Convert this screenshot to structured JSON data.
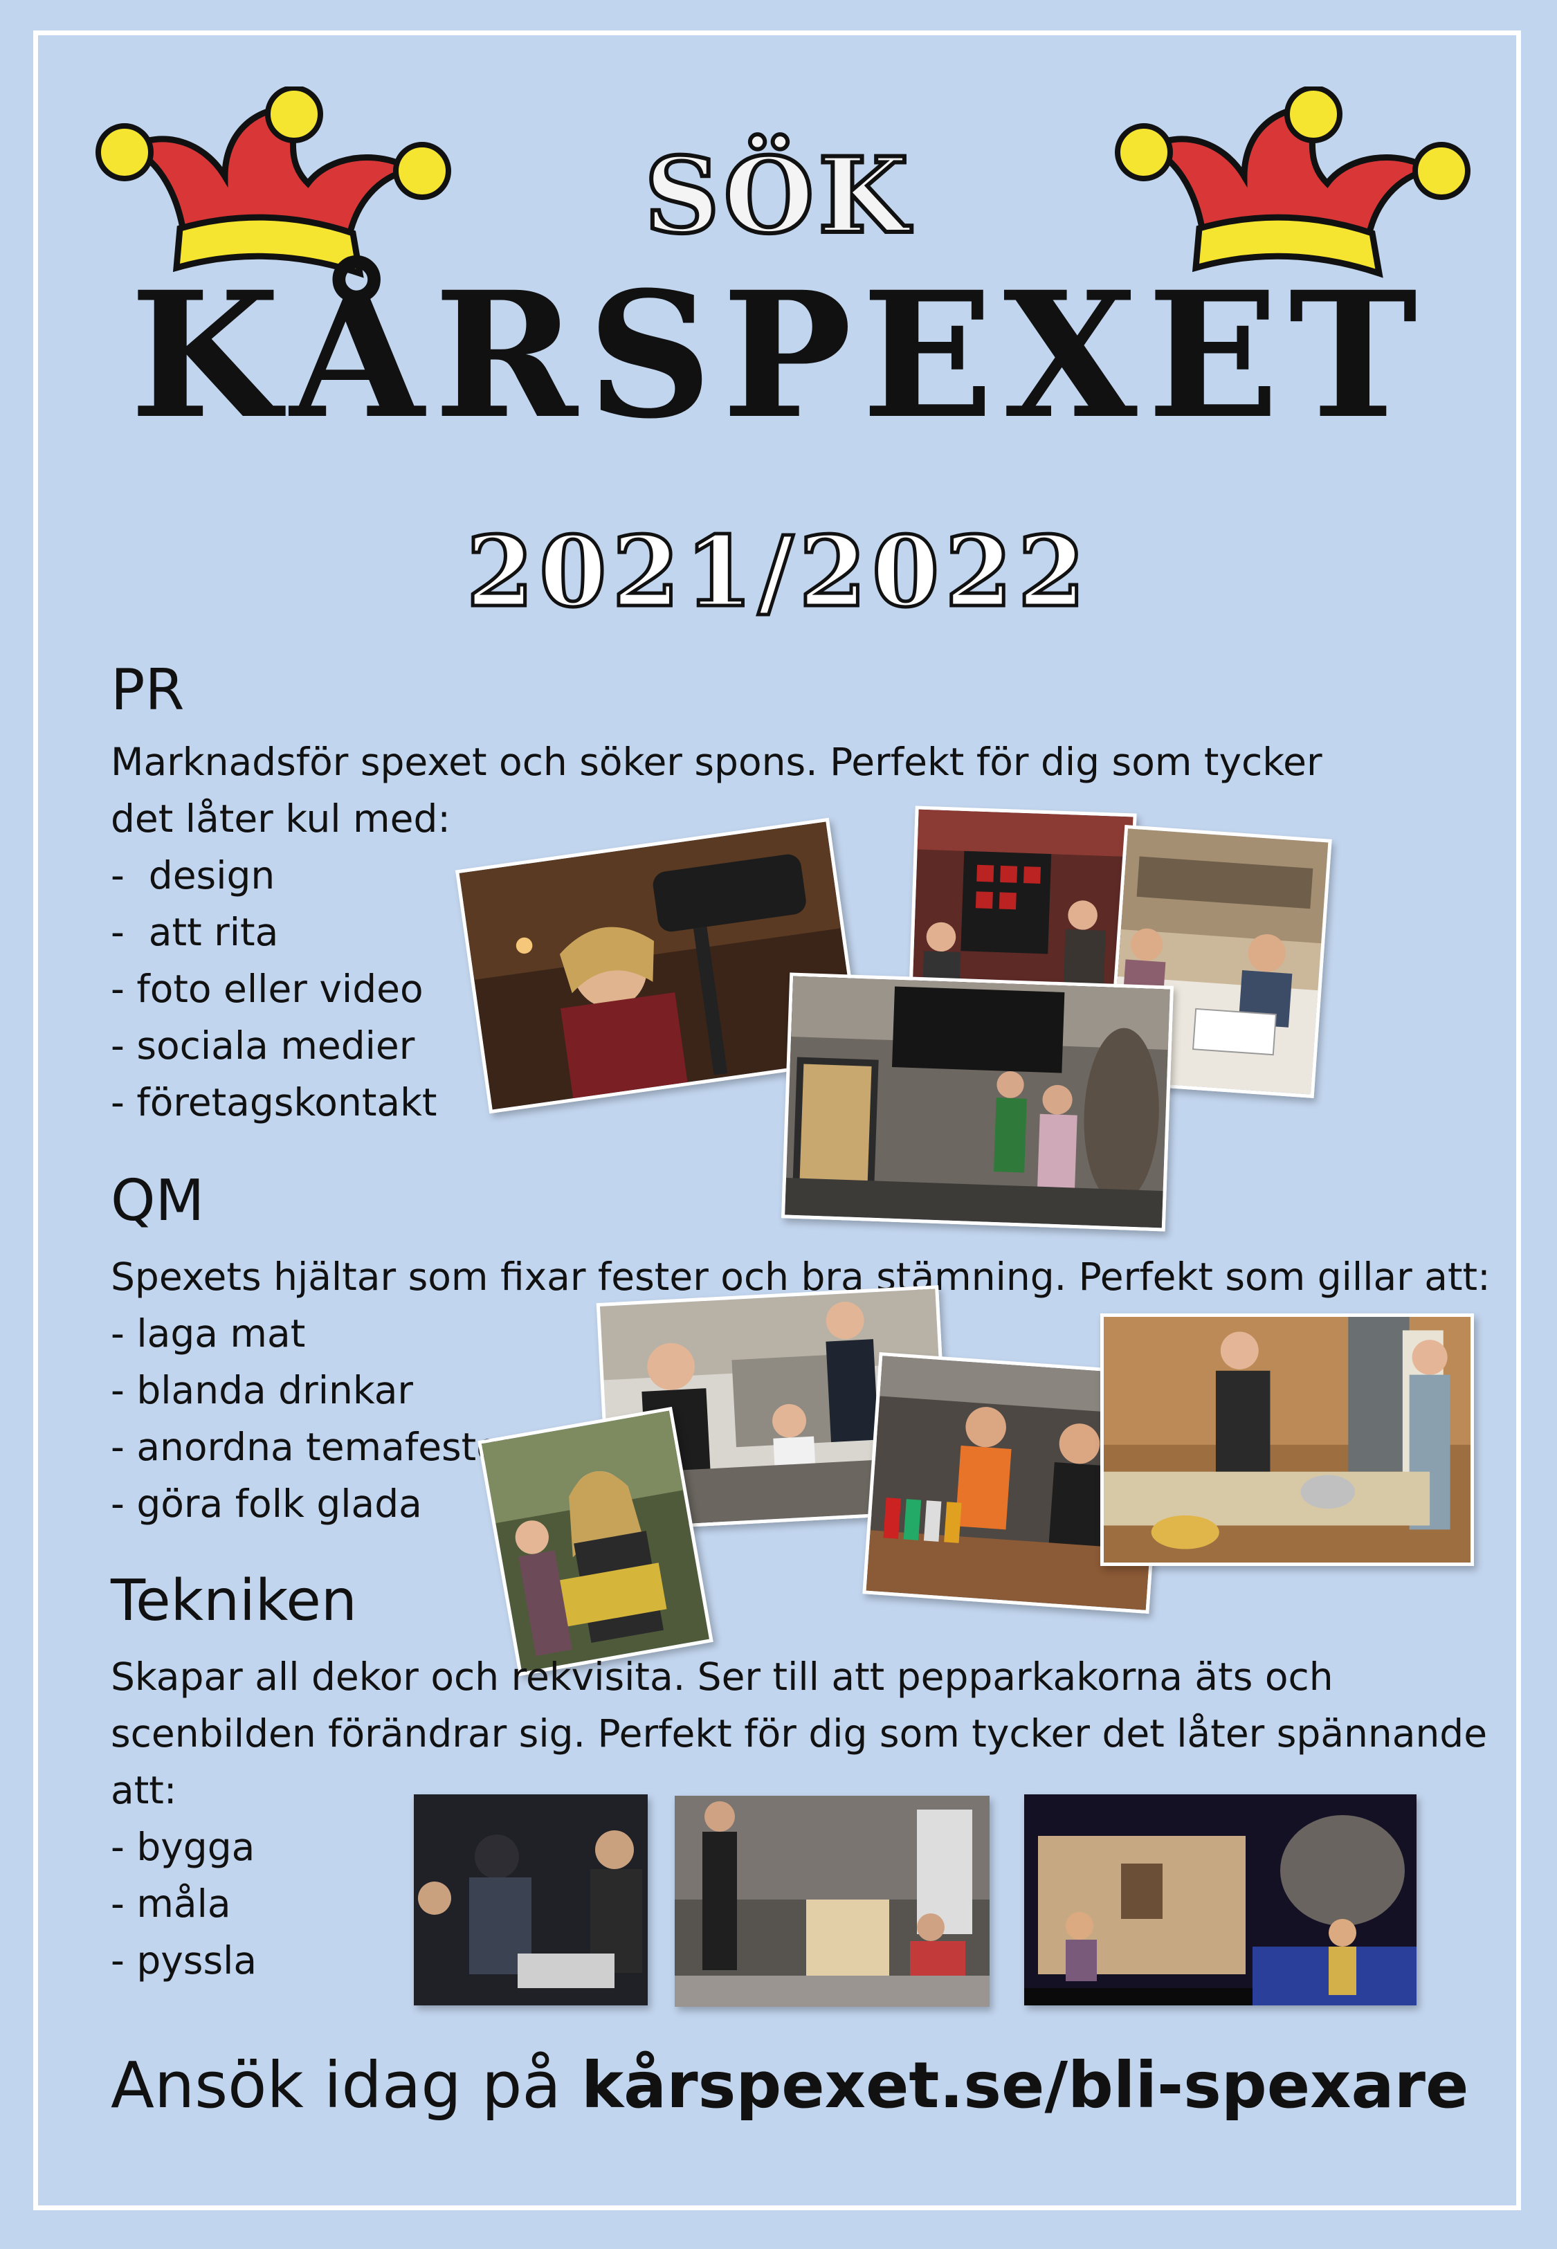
{
  "header": {
    "sok": "SÖK",
    "brand": "KÅRSPEXET",
    "year": "2021/2022"
  },
  "sections": [
    {
      "title": "PR",
      "lines": [
        "Marknadsför spexet och söker spons. Perfekt för dig som tycker",
        "det låter kul med:",
        "-  design",
        "-  att rita",
        "- foto eller video",
        "- sociala medier",
        "- företagskontakt"
      ]
    },
    {
      "title": "QM",
      "lines": [
        "Spexets hjältar som fixar fester och bra stämning. Perfekt som gillar att:",
        "- laga mat",
        "- blanda drinkar",
        "- anordna temafester",
        "- göra folk glada"
      ]
    },
    {
      "title": "Tekniken",
      "lines": [
        "Skapar all dekor och rekvisita. Ser till att pepparkakorna äts och",
        "scenbilden förändrar sig. Perfekt för dig som tycker det låter spännande",
        "att:",
        "- bygga",
        "- måla",
        "- pyssla"
      ]
    }
  ],
  "cta": {
    "prefix": "Ansök idag på ",
    "url": "kårspexet.se/bli-spexare"
  },
  "colors": {
    "background": "#c2d5ee",
    "frame": "#ffffff",
    "hat_red": "#d93737",
    "hat_yellow": "#f5e531",
    "text": "#111111"
  },
  "icons": [
    "jester-hat-icon",
    "jester-hat-icon"
  ]
}
